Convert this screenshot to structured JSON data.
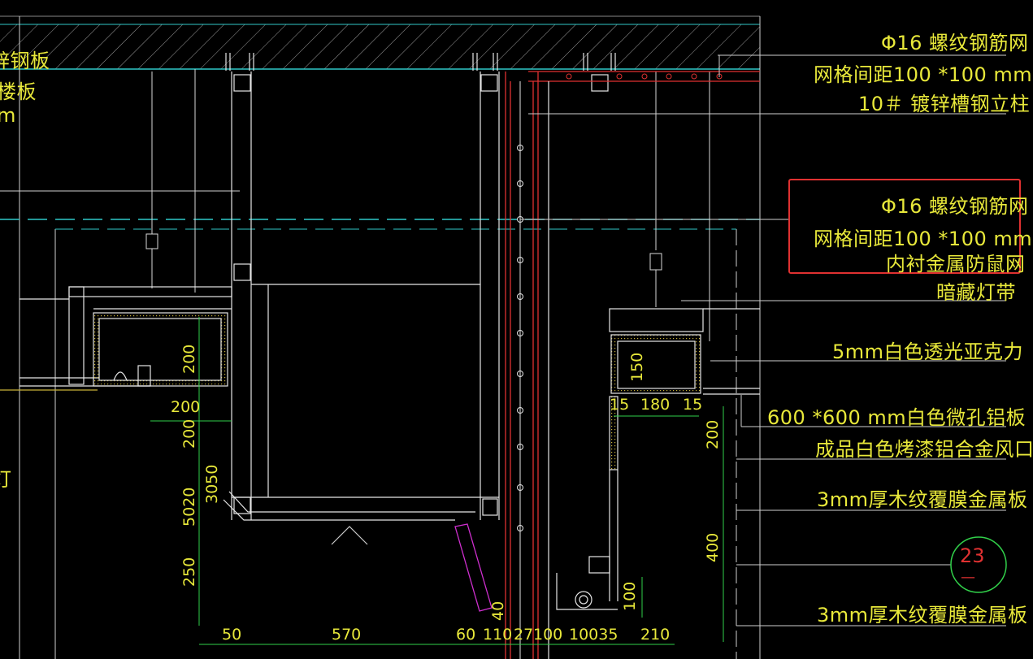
{
  "right_labels": [
    {
      "id": "r1",
      "text": "Φ16 螺纹钢筋网"
    },
    {
      "id": "r2",
      "text": "网格间距100 *100 mm"
    },
    {
      "id": "r3",
      "text": "10＃ 镀锌槽钢立柱"
    },
    {
      "id": "r4",
      "text": "Φ16 螺纹钢筋网"
    },
    {
      "id": "r5",
      "text": "网格间距100 *100 mm"
    },
    {
      "id": "r6",
      "text": "内衬金属防鼠网"
    },
    {
      "id": "r7",
      "text": "暗藏灯带"
    },
    {
      "id": "r8",
      "text": "5mm白色透光亚克力"
    },
    {
      "id": "r9",
      "text": "600 *600 mm白色微孔铝板"
    },
    {
      "id": "r10",
      "text": "成品白色烤漆铝合金风口"
    },
    {
      "id": "r11",
      "text": "3mm厚木纹覆膜金属板"
    },
    {
      "id": "r12",
      "text": "3mm厚木纹覆膜金属板"
    }
  ],
  "left_labels": [
    {
      "id": "l1",
      "text": "锌钢板"
    },
    {
      "id": "l2",
      "text": "楼板"
    },
    {
      "id": "l3",
      "text": "m"
    },
    {
      "id": "l4",
      "text": "灯"
    }
  ],
  "dims_horizontal": [
    {
      "id": "h200",
      "text": "200"
    },
    {
      "id": "h15a",
      "text": "15"
    },
    {
      "id": "h180",
      "text": "180"
    },
    {
      "id": "h15b",
      "text": "15"
    },
    {
      "id": "b50",
      "text": "50"
    },
    {
      "id": "b570",
      "text": "570"
    },
    {
      "id": "b60",
      "text": "60"
    },
    {
      "id": "b110",
      "text": "110"
    },
    {
      "id": "b27",
      "text": "27"
    },
    {
      "id": "b100",
      "text": "100"
    },
    {
      "id": "b10035",
      "text": "10035"
    },
    {
      "id": "b210",
      "text": "210"
    }
  ],
  "dims_vertical": [
    {
      "id": "v200a",
      "text": "200"
    },
    {
      "id": "v200b",
      "text": "200"
    },
    {
      "id": "v3050",
      "text": "3050"
    },
    {
      "id": "v5020",
      "text": "5020"
    },
    {
      "id": "v250",
      "text": "250"
    },
    {
      "id": "v150",
      "text": "150"
    },
    {
      "id": "v200c",
      "text": "200"
    },
    {
      "id": "v400",
      "text": "400"
    },
    {
      "id": "v100",
      "text": "100"
    },
    {
      "id": "v40",
      "text": "40"
    }
  ],
  "section_tag": {
    "number": "23",
    "sub": "—"
  },
  "colors": {
    "background": "#000000",
    "line": "#d8d8d8",
    "text": "#e8e83a",
    "red": "#e03131",
    "cyan": "#2fc7c7",
    "green": "#31d04a",
    "magenta": "#d02fd0"
  }
}
